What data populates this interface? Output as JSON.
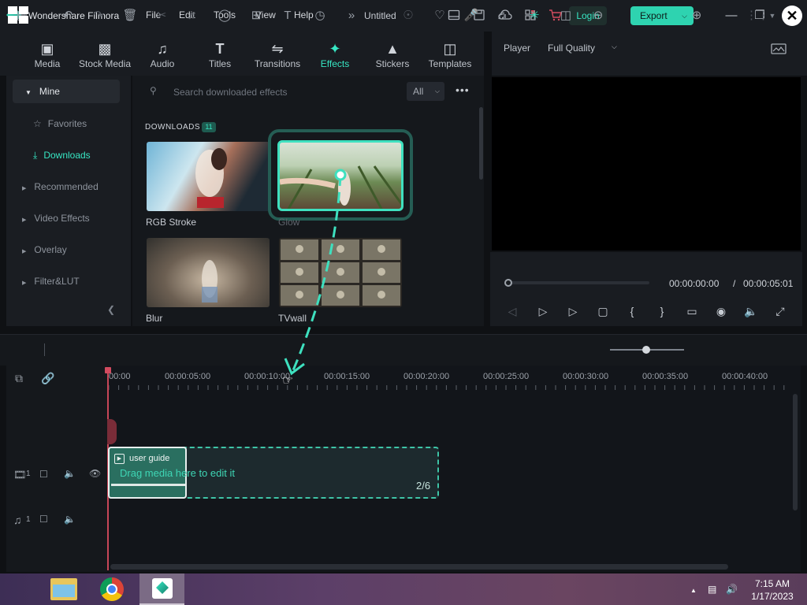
{
  "app": {
    "name": "Wondershare Filmora",
    "document_title": "Untitled",
    "menu": [
      "File",
      "Edit",
      "Tools",
      "View",
      "Help"
    ],
    "login_label": "Login",
    "export_label": "Export"
  },
  "tabs": [
    {
      "label": "Media",
      "icon": "media-icon"
    },
    {
      "label": "Stock Media",
      "icon": "stock-media-icon"
    },
    {
      "label": "Audio",
      "icon": "music-note-icon"
    },
    {
      "label": "Titles",
      "icon": "text-t-icon"
    },
    {
      "label": "Transitions",
      "icon": "transitions-icon"
    },
    {
      "label": "Effects",
      "icon": "effects-sparkle-icon",
      "active": true
    },
    {
      "label": "Stickers",
      "icon": "stickers-icon"
    },
    {
      "label": "Templates",
      "icon": "templates-icon"
    }
  ],
  "sidebar": {
    "mine_label": "Mine",
    "items": [
      {
        "label": "Favorites",
        "icon": "star-icon"
      },
      {
        "label": "Downloads",
        "icon": "download-icon",
        "active": true
      },
      {
        "label": "Recommended"
      },
      {
        "label": "Video Effects"
      },
      {
        "label": "Overlay"
      },
      {
        "label": "Filter&LUT"
      }
    ]
  },
  "effects": {
    "search_placeholder": "Search downloaded effects",
    "filter_value": "All",
    "section_label": "DOWNLOADS",
    "section_count": "11",
    "items": [
      {
        "name": "RGB Stroke"
      },
      {
        "name": "Glow",
        "selected": true
      },
      {
        "name": "Blur"
      },
      {
        "name": "TVwall"
      }
    ]
  },
  "player": {
    "label": "Player",
    "quality": "Full Quality",
    "current_time": "00:00:00:00",
    "separator": "/",
    "total_time": "00:00:05:01"
  },
  "timeline": {
    "ruler": [
      "00:00",
      "00:00:05:00",
      "00:00:10:00",
      "00:00:15:00",
      "00:00:20:00",
      "00:00:25:00",
      "00:00:30:00",
      "00:00:35:00",
      "00:00:40:00"
    ],
    "video_track_number": "1",
    "audio_track_number": "1",
    "clip_name": "user guide",
    "drop_hint": "Drag media here to edit it",
    "drop_count": "2/6"
  },
  "taskbar": {
    "time": "7:15 AM",
    "date": "1/17/2023"
  },
  "colors": {
    "accent": "#37e6c3",
    "playhead": "#c74658",
    "background": "#0f1114"
  }
}
